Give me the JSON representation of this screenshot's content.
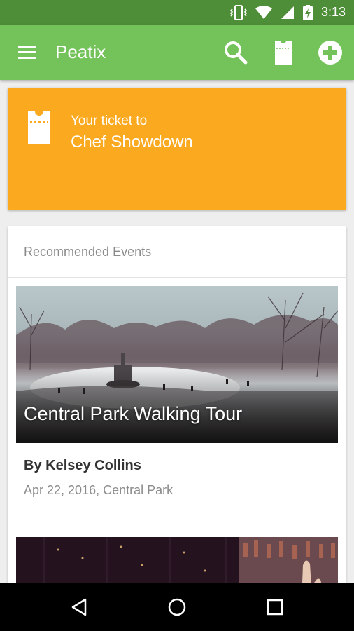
{
  "status_bar": {
    "time": "3:13",
    "icons": [
      "vibrate-icon",
      "wifi-icon",
      "cell-signal-icon",
      "battery-charging-icon"
    ]
  },
  "app_bar": {
    "title": "Peatix",
    "menu_icon": "hamburger-menu-icon",
    "actions": [
      "search-icon",
      "ticket-icon",
      "add-circle-icon"
    ]
  },
  "ticket_card": {
    "label": "Your ticket to",
    "event_name": "Chef Showdown",
    "icon": "ticket-icon",
    "color": "#fbaa1f"
  },
  "recommended": {
    "header": "Recommended Events",
    "events": [
      {
        "title": "Central Park Walking Tour",
        "organizer": "By Kelsey Collins",
        "date_location": "Apr 22, 2016, Central Park"
      }
    ]
  },
  "nav_bar": {
    "buttons": [
      "back-icon",
      "home-icon",
      "recent-apps-icon"
    ]
  },
  "colors": {
    "status_bar": "#4e8e38",
    "app_bar": "#73c25a",
    "ticket_card": "#fbaa1f",
    "background": "#eeeeee"
  }
}
